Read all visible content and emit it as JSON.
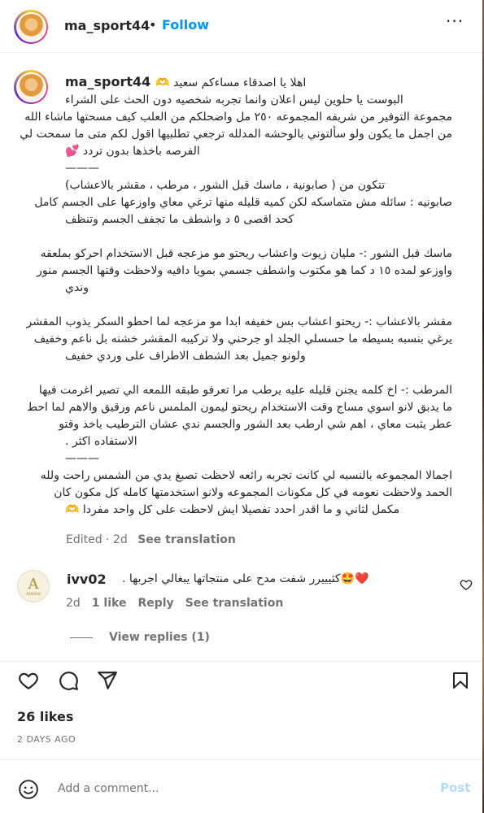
{
  "header": {
    "username": "ma_sport44",
    "dot": "•",
    "follow_label": "Follow",
    "more_label": "···"
  },
  "caption": {
    "username": "ma_sport44",
    "greeting": "اهلا يا اصدقاء مساءكم سعيد 🫶",
    "lines": [
      "البوست يا حلوين ليس اعلان وانما تجربه شخصيه دون الحث على الشراء",
      "مجموعة التوفير من شريفه المجموعه ٢٥٠ مل واضحلكم من العلب كيف مسحتها ماشاء الله",
      "من اجمل ما يكون ولو سألتوني بالوحشه المدلله ترجعي تطلبيها اقول لكم متى ما سمحت لي",
      "الفرصه باخذها بدون تردد 💕",
      "———",
      "تتكون من ( صابونية ، ماسك قبل الشور ، مرطب ، مقشر بالاعشاب)",
      "صابونيه : سائله مش متماسكه لكن كميه قليله منها ترغي معاي واوزعها على الجسم كامل",
      "كحد اقصى ٥ د واشطف ما تجفف الجسم وتنظف",
      "",
      "ماسك قبل الشور :- مليان زيوت واعشاب ريحتو مو مزعجه قبل الاستخدام احركو بملعقه",
      "واوزعو لمده ١٥ د كما هو مكتوب واشطف جسمي بمويا دافيه ولاحظت وقتها الجسم منور",
      "وندي",
      "",
      "مقشر بالاعشاب :- ريحتو اعشاب بس خفيفه ابدا مو مزعجه لما احطو السكر يذوب المقشر",
      "يرغي بنسبه بسيطه ما حسسلي الجلد او جرحني ولا تركيبه المقشر خشنه بل ناعم وخفيف",
      "ولونو جميل بعد الشطف الاطراف على وردي خفيف",
      "",
      "المرطب :- اخ كلمه يجنن قليله عليه يرطب مرا تعرفو طبقه اللمعه الي تصير اغرمت فيها",
      "ما يدبق لانو اسوي مساج وقت الاستخدام ريحتو ليمون الملمس ناعم ورقيق والاهم لما احط",
      "عطر يثبت معاي ، اهم شي ارطب بعد الشور والجسم ندي عشان الترطيب ياخذ وقتو",
      "الاستفاده اكثر .",
      "———",
      "اجمالا المجموعه بالنسبه لي كانت تجربه رائعه لاحظت تصبغ يدي من الشمس راحت ولله",
      "الحمد ولاحظت نعومه في كل مكونات المجموعه ولانو استخدمتها كامله كل مكون كان",
      "مكمل لثاني و ما اقدر احدد تفصيلا ايش لاحظت على كل واحد مفردا 🫶"
    ],
    "edited": "Edited · 2d",
    "see_translation": "See translation"
  },
  "comment": {
    "avatar_letter": "A",
    "avatar_text": "ARABIAN",
    "username": "ivv02",
    "text": "❤️🤩كثيييرر شفت مدح على منتجاتها يبغالي اجربها .",
    "age": "2d",
    "likes": "1 like",
    "reply": "Reply",
    "see_translation": "See translation",
    "view_replies": "View replies (1)"
  },
  "actions": {
    "like": "heart-icon",
    "comment": "comment-icon",
    "share": "share-icon",
    "save": "bookmark-icon"
  },
  "likes": "26 likes",
  "date": "2 DAYS AGO",
  "add_comment": {
    "placeholder": "Add a comment...",
    "post_label": "Post"
  },
  "colors": {
    "link_blue": "#0095f6",
    "post_disabled": "#b3dbff",
    "secondary_text": "#737373"
  }
}
